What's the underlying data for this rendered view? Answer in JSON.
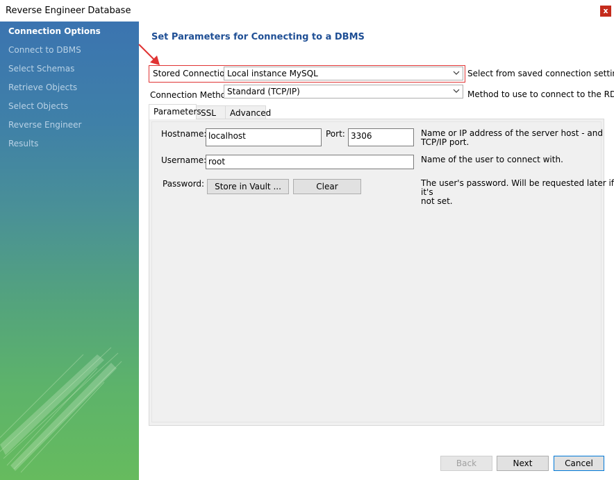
{
  "window": {
    "title": "Reverse Engineer Database",
    "close_label": "x"
  },
  "sidebar": {
    "steps": [
      {
        "label": "Connection Options",
        "active": true
      },
      {
        "label": "Connect to DBMS"
      },
      {
        "label": "Select Schemas"
      },
      {
        "label": "Retrieve Objects"
      },
      {
        "label": "Select Objects"
      },
      {
        "label": "Reverse Engineer"
      },
      {
        "label": "Results"
      }
    ]
  },
  "main": {
    "heading": "Set Parameters for Connecting to a DBMS",
    "stored_connection": {
      "label": "Stored Connection:",
      "value": "Local instance MySQL",
      "hint": "Select from saved connection settings"
    },
    "connection_method": {
      "label": "Connection Method:",
      "value": "Standard (TCP/IP)",
      "hint": "Method to use to connect to the RDBMS"
    },
    "tabs": [
      {
        "label": "Parameters"
      },
      {
        "label": "SSL"
      },
      {
        "label": "Advanced"
      }
    ],
    "parameters": {
      "hostname": {
        "label": "Hostname:",
        "value": "localhost"
      },
      "port": {
        "label": "Port:",
        "value": "3306"
      },
      "host_desc_line1": "Name or IP address of the server host - and",
      "host_desc_line2": "TCP/IP port.",
      "username": {
        "label": "Username:",
        "value": "root"
      },
      "username_desc": "Name of the user to connect with.",
      "password": {
        "label": "Password:",
        "store_button": "Store in Vault ...",
        "clear_button": "Clear"
      },
      "password_desc_line1": "The user's password. Will be requested later if it's",
      "password_desc_line2": "not set."
    }
  },
  "footer": {
    "back_label": "Back",
    "next_label": "Next",
    "cancel_label": "Cancel"
  },
  "colors": {
    "accent": "#1f4f95",
    "highlight_box": "#e03333",
    "close": "#c42b1c"
  },
  "icons": {
    "annotation_arrow": "red-arrow-icon",
    "dropdown": "chevron-down-icon"
  }
}
